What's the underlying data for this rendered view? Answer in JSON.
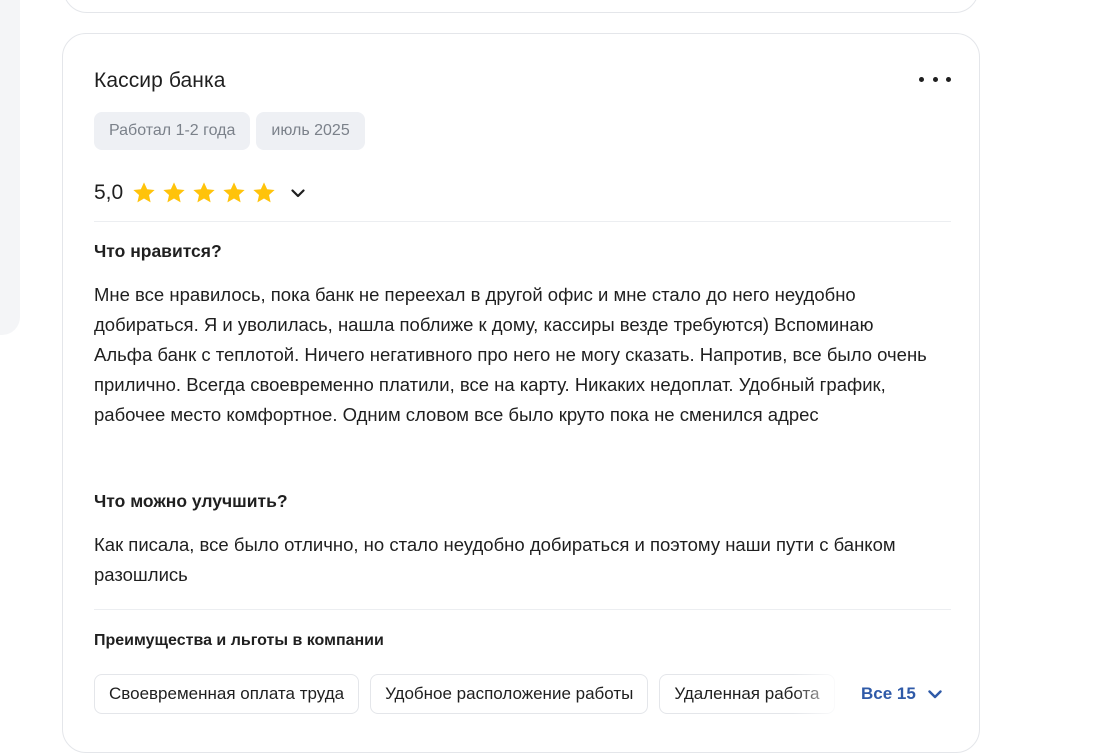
{
  "review": {
    "position": "Кассир банка",
    "tags": [
      "Работал 1-2 года",
      "июль 2025"
    ],
    "rating": "5,0",
    "stars_filled": 5,
    "stars_total": 5,
    "likes_title": "Что нравится?",
    "likes_text": "Мне все нравилось, пока банк не переехал в другой офис и мне стало до него неудобно добираться. Я и уволилась, нашла поближе к дому, кассиры везде требуются) Вспоминаю Альфа банк с теплотой. Ничего негативного про него не могу сказать. Напротив, все было очень прилично. Всегда своевременно платили, все на карту. Никаких недоплат. Удобный график, рабочее место комфортное. Одним словом все было круто пока не сменился адрес",
    "improve_title": "Что можно улучшить?",
    "improve_text": "Как писала, все было отлично, но стало неудобно добираться и поэтому наши пути с банком разошлись",
    "benefits_title": "Преимущества и льготы в компании",
    "benefits": [
      "Своевременная оплата труда",
      "Удобное расположение работы",
      "Удаленная работа"
    ],
    "show_all_label": "Все 15"
  },
  "icons": {
    "more": "more-horizontal-icon",
    "star": "star-icon",
    "rating_expand": "chevron-down-icon",
    "show_all": "chevron-down-icon"
  },
  "colors": {
    "star": "#FFC30B",
    "link": "#2F5AA8",
    "tag_bg": "#EEF0F4",
    "tag_text": "#7B818A"
  }
}
